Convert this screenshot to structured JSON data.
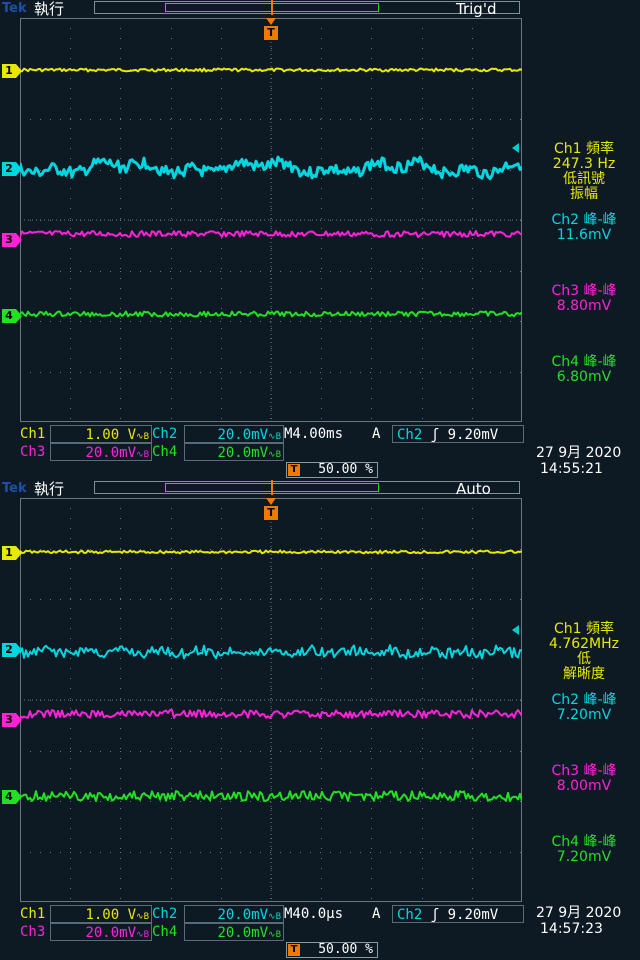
{
  "screens": [
    {
      "brand": "Tek",
      "run_state": "執行",
      "trig_status": "Trig'd",
      "channels": [
        {
          "id": "1",
          "color": "#e8e800"
        },
        {
          "id": "2",
          "color": "#00d6e0"
        },
        {
          "id": "3",
          "color": "#ff22d8"
        },
        {
          "id": "4",
          "color": "#22e022"
        }
      ],
      "trigger_marker": "T",
      "measurements": {
        "ch1_title": "Ch1 頻率",
        "ch1_value": "247.3 Hz",
        "ch1_note1": "低訊號",
        "ch1_note2": "振幅",
        "ch2_title": "Ch2 峰-峰",
        "ch2_value": "11.6mV",
        "ch3_title": "Ch3 峰-峰",
        "ch3_value": "8.80mV",
        "ch4_title": "Ch4 峰-峰",
        "ch4_value": "6.80mV"
      },
      "readout": {
        "ch1_label": "Ch1",
        "ch1_scale": "1.00 V",
        "ch2_label": "Ch2",
        "ch2_scale": "20.0mV",
        "ch3_label": "Ch3",
        "ch3_scale": "20.0mV",
        "ch4_label": "Ch4",
        "ch4_scale": "20.0mV",
        "timebase": "M4.00ms",
        "trig_mode": "A",
        "trig_source": "Ch2",
        "trig_slope": "ʃ",
        "trig_level": "9.20mV",
        "trig_position": "50.00 %"
      },
      "date": "27 9月  2020",
      "time": "14:55:21"
    },
    {
      "brand": "Tek",
      "run_state": "執行",
      "trig_status": "Auto",
      "channels": [
        {
          "id": "1",
          "color": "#e8e800"
        },
        {
          "id": "2",
          "color": "#00d6e0"
        },
        {
          "id": "3",
          "color": "#ff22d8"
        },
        {
          "id": "4",
          "color": "#22e022"
        }
      ],
      "trigger_marker": "T",
      "measurements": {
        "ch1_title": "Ch1 頻率",
        "ch1_value": "4.762MHz",
        "ch1_note1": "低",
        "ch1_note2": "解晰度",
        "ch2_title": "Ch2 峰-峰",
        "ch2_value": "7.20mV",
        "ch3_title": "Ch3 峰-峰",
        "ch3_value": "8.00mV",
        "ch4_title": "Ch4 峰-峰",
        "ch4_value": "7.20mV"
      },
      "readout": {
        "ch1_label": "Ch1",
        "ch1_scale": "1.00 V",
        "ch2_label": "Ch2",
        "ch2_scale": "20.0mV",
        "ch3_label": "Ch3",
        "ch3_scale": "20.0mV",
        "ch4_label": "Ch4",
        "ch4_scale": "20.0mV",
        "timebase": "M40.0µs",
        "trig_mode": "A",
        "trig_source": "Ch2",
        "trig_slope": "ʃ",
        "trig_level": "9.20mV",
        "trig_position": "50.00 %"
      },
      "date": "27 9月  2020",
      "time": "14:57:23"
    }
  ],
  "colors": {
    "background": "#0d1a24",
    "grid": "#6a7680",
    "trigger": "#f07a00",
    "ch1": "#e8e800",
    "ch2": "#00d6e0",
    "ch3": "#ff22d8",
    "ch4": "#22e022"
  }
}
